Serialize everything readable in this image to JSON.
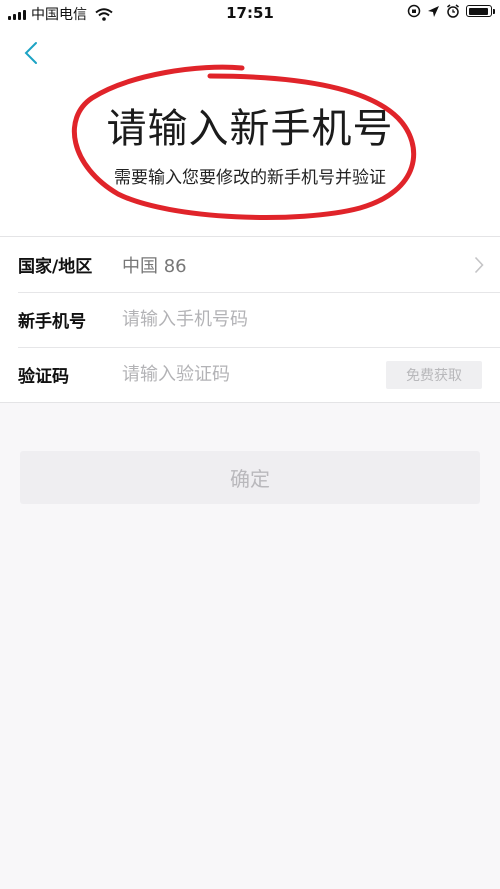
{
  "status_bar": {
    "carrier": "中国电信",
    "time": "17:51",
    "battery_level": 0.95
  },
  "header": {
    "title": "请输入新手机号",
    "subtitle": "需要输入您要修改的新手机号并验证"
  },
  "form": {
    "region": {
      "label": "国家/地区",
      "value": "中国 86"
    },
    "phone": {
      "label": "新手机号",
      "placeholder": "请输入手机号码"
    },
    "code": {
      "label": "验证码",
      "placeholder": "请输入验证码",
      "button_label": "免费获取"
    }
  },
  "confirm_label": "确定",
  "colors": {
    "accent": "#1ca3c4",
    "annotation_red": "#e0242a",
    "background": "#f8f7f9"
  },
  "icons": [
    "signal-icon",
    "wifi-icon",
    "location-lock-icon",
    "navigation-arrow-icon",
    "alarm-icon",
    "battery-icon",
    "back-chevron-icon",
    "chevron-right-icon"
  ]
}
